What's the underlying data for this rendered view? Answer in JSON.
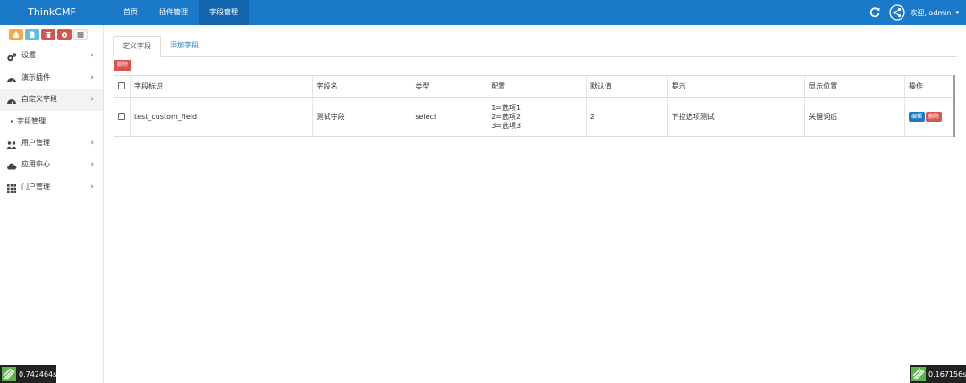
{
  "app": {
    "brand": "ThinkCMF"
  },
  "nav": {
    "tabs": [
      {
        "label": "首页"
      },
      {
        "label": "插件管理"
      },
      {
        "label": "字段管理"
      }
    ],
    "welcome": "欢迎, admin",
    "caret": "▾"
  },
  "sidebar": {
    "items": [
      {
        "label": "设置",
        "icon": "cogs-icon"
      },
      {
        "label": "演示插件",
        "icon": "dashboard-icon"
      },
      {
        "label": "自定义字段",
        "icon": "dashboard-icon"
      },
      {
        "label": "字段管理"
      },
      {
        "label": "用户管理",
        "icon": "users-icon"
      },
      {
        "label": "应用中心",
        "icon": "cloud-icon"
      },
      {
        "label": "门户管理",
        "icon": "grid-icon"
      }
    ],
    "chevron": "›",
    "sub_caret": "▸"
  },
  "tabs": {
    "defined": "定义字段",
    "add": "添加字段"
  },
  "actions": {
    "delete": "删除",
    "edit": "编辑"
  },
  "table": {
    "headers": [
      "字段标识",
      "字段名",
      "类型",
      "配置",
      "默认值",
      "提示",
      "显示位置",
      "操作"
    ],
    "rows": [
      {
        "key": "test_custom_field",
        "name": "测试字段",
        "type": "select",
        "config": [
          "1=选项1",
          "2=选项2",
          "3=选项3"
        ],
        "default": "2",
        "hint": "下拉选项测试",
        "position": "关键词后"
      }
    ]
  },
  "timers": {
    "left": "0.742464s",
    "right": "0.167156s"
  },
  "colors": {
    "navbar": "#1a79c9",
    "danger": "#d9534f",
    "primary": "#1a79c9"
  }
}
